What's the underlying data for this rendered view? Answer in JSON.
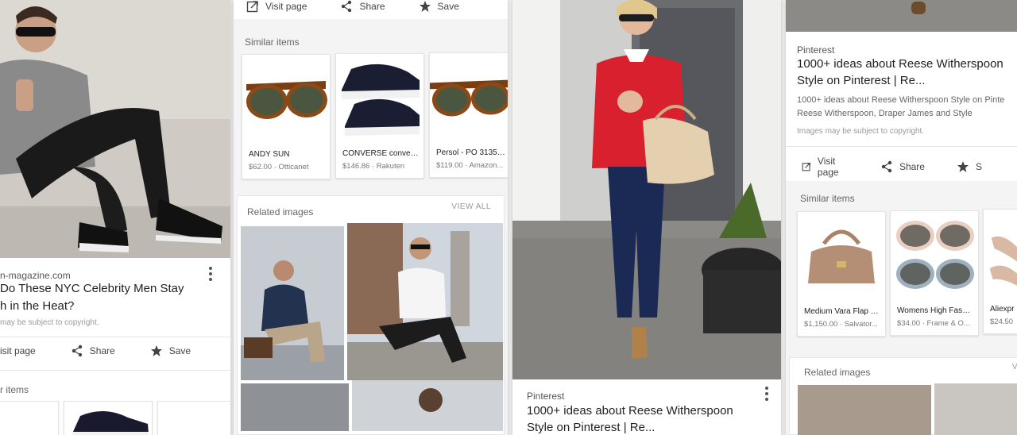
{
  "colors": {
    "accent_red": "#d8202f",
    "text": "#222222",
    "muted": "#777777"
  },
  "panel1": {
    "source": "n-magazine.com",
    "title_line1": "Do These NYC Celebrity Men Stay",
    "title_line2": "h in the Heat?",
    "copyright": "may be subject to copyright.",
    "visit_label": "isit page",
    "share_label": "Share",
    "save_label": "Save",
    "similar_label": "r items"
  },
  "panel2": {
    "visit_label": "Visit page",
    "share_label": "Share",
    "save_label": "Save",
    "similar_label": "Similar items",
    "items": [
      {
        "name": "ANDY SUN",
        "meta": "$62.00 · Otticanet",
        "icon": "sunglasses-tortoise-icon"
      },
      {
        "name": "CONVERSE convers...",
        "meta": "$146.86 · Rakuten",
        "icon": "sneaker-icon"
      },
      {
        "name": "Persol - PO 3135S...",
        "meta": "$119.00 · Amazon...",
        "icon": "sunglasses-tortoise-icon"
      }
    ],
    "related_label": "Related images",
    "view_all": "VIEW ALL"
  },
  "panel3": {
    "source": "Pinterest",
    "title_line1": "1000+ ideas about Reese Witherspoon",
    "title_line2": "Style on Pinterest | Re..."
  },
  "panel4": {
    "source": "Pinterest",
    "title_line1": "1000+ ideas about Reese Witherspoon",
    "title_line2": "Style on Pinterest | Re...",
    "desc_line1": "1000+ ideas about Reese Witherspoon Style on Pinte",
    "desc_line2": "Reese Witherspoon, Draper James and Style",
    "copyright": "Images may be subject to copyright.",
    "visit_label": "Visit page",
    "share_label": "Share",
    "save_label": "S",
    "similar_label": "Similar items",
    "items": [
      {
        "name": "Medium Vara Flap B...",
        "meta": "$1,150.00 · Salvator...",
        "icon": "handbag-icon"
      },
      {
        "name": "Womens High Fashi...",
        "meta": "$34.00 · Frame & O...",
        "icon": "sunglasses-pink-icon"
      },
      {
        "name": "Aliexpr",
        "meta": "$24.50",
        "icon": "heels-icon"
      }
    ],
    "related_label": "Related images",
    "view_all": "V"
  }
}
